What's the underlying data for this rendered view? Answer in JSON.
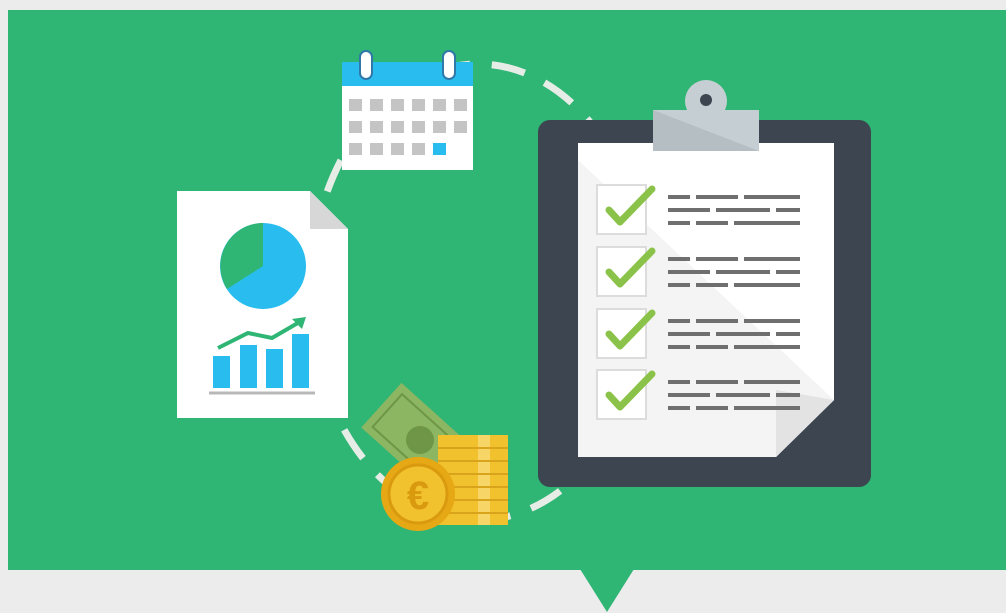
{
  "illustration": {
    "colors": {
      "banner": "#2fb574",
      "page_background": "#ececec",
      "accent_blue": "#29bdef",
      "chart_green": "#2fb574",
      "clipboard_board": "#3d4550",
      "check_green": "#8bc34a",
      "coin_gold": "#f2c12e",
      "banknote_green": "#8db662",
      "dash_ring": "#e6ece6"
    },
    "icons": [
      "calendar-icon",
      "report-document-icon",
      "pie-chart-icon",
      "bar-chart-icon",
      "trend-arrow-icon",
      "clipboard-checklist-icon",
      "checkmark-icon",
      "banknote-icon",
      "coin-stack-icon",
      "euro-coin-icon"
    ],
    "checklist": {
      "items_checked": [
        true,
        true,
        true,
        true
      ]
    },
    "calendar": {
      "highlighted_cell": "row 3, column 5"
    },
    "coin_symbol": "€"
  }
}
